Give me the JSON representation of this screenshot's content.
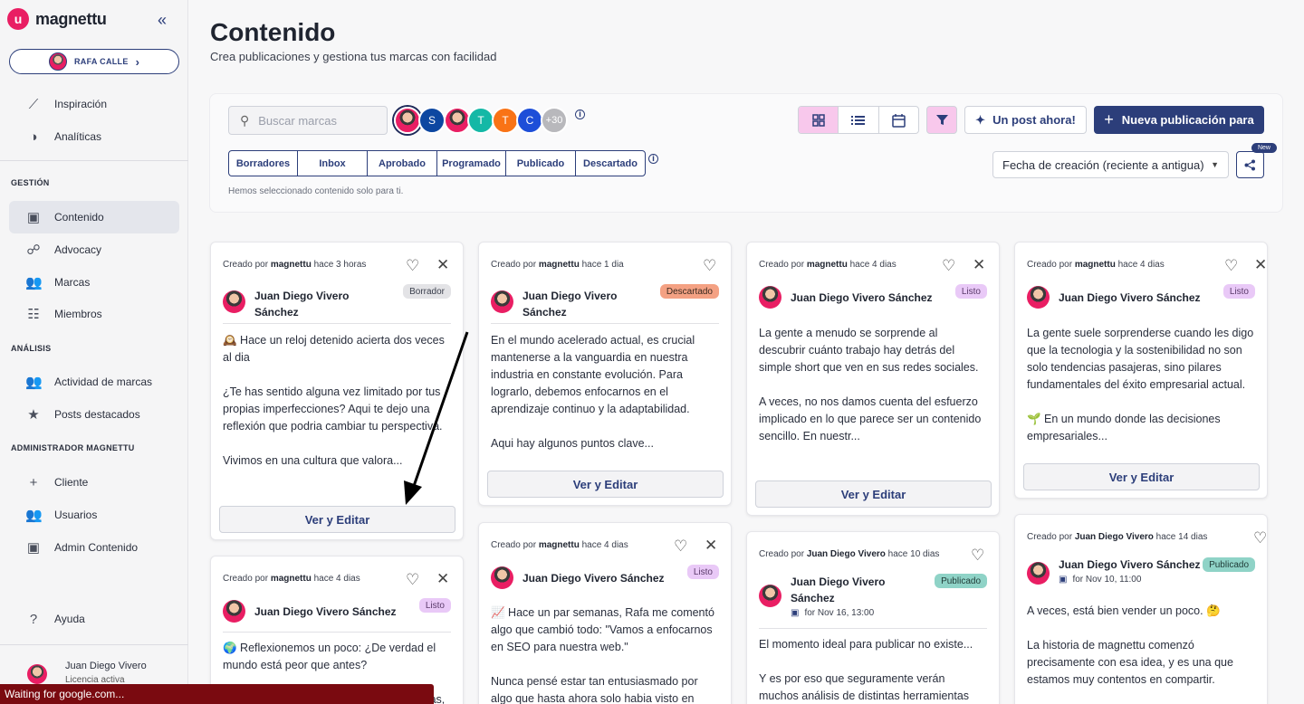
{
  "app": {
    "name": "magnettu",
    "logo_letter": "u",
    "collapse_icon": "«"
  },
  "user_pill": {
    "name": "RAFA CALLE",
    "chevron": "›"
  },
  "nav": {
    "top": [
      {
        "label": "Inspiración",
        "icon": "⟋"
      },
      {
        "label": "Analíticas",
        "icon": "◑"
      }
    ],
    "gestion_label": "GESTIÓN",
    "gestion": [
      {
        "label": "Contenido",
        "icon": "▣"
      },
      {
        "label": "Advocacy",
        "icon": "☍"
      },
      {
        "label": "Marcas",
        "icon": "👥"
      },
      {
        "label": "Miembros",
        "icon": "☷"
      }
    ],
    "analisis_label": "ANÁLISIS",
    "analisis": [
      {
        "label": "Actividad de marcas",
        "icon": "👥"
      },
      {
        "label": "Posts destacados",
        "icon": "★"
      }
    ],
    "admin_label": "ADMINISTRADOR MAGNETTU",
    "admin": [
      {
        "label": "Cliente",
        "icon": "+"
      },
      {
        "label": "Usuarios",
        "icon": "👥"
      },
      {
        "label": "Admin Contenido",
        "icon": "▣"
      }
    ],
    "help": {
      "label": "Ayuda",
      "icon": "?"
    }
  },
  "bottom_user": {
    "name": "Juan Diego Vivero",
    "subtitle": "Licencia activa"
  },
  "header": {
    "title": "Contenido",
    "subtitle": "Crea publicaciones y gestiona tus marcas con facilidad"
  },
  "toolbar": {
    "search_placeholder": "Buscar marcas",
    "brand_avatars": [
      {
        "text": "",
        "color": "#e91e63"
      },
      {
        "text": "S",
        "color": "#0d47a1"
      },
      {
        "text": "",
        "color": "#e91e63"
      },
      {
        "text": "T",
        "color": "#14b8a6"
      },
      {
        "text": "T",
        "color": "#f97316"
      },
      {
        "text": "C",
        "color": "#1d4ed8"
      },
      {
        "text": "+30",
        "color": "#b8b8bc"
      }
    ],
    "views": [
      "grid-icon",
      "list-icon",
      "calendar-icon"
    ],
    "ai_button": "Un post ahora!",
    "new_button": "Nueva publicación para",
    "tabs": [
      "Borradores",
      "Inbox",
      "Aprobado",
      "Programado",
      "Publicado",
      "Descartado"
    ],
    "hint": "Hemos seleccionado contenido solo para ti.",
    "sort_value": "Fecha de creación (reciente a antigua)",
    "new_badge": "New"
  },
  "cards": [
    {
      "meta_prefix": "Creado por",
      "creator": "magnettu",
      "time": "hace 3 horas",
      "author": "Juan Diego Vivero Sánchez",
      "status": "Borrador",
      "status_class": "st-borrador",
      "body": "🕰️ Hace un reloj detenido acierta dos veces al dia\n\n¿Te has sentido alguna vez limitado por tus propias imperfecciones? Aqui te dejo una reflexión que podria cambiar tu perspectiva.\n\nVivimos en una cultura que valora...",
      "button": "Ver y Editar"
    },
    {
      "meta_prefix": "Creado por",
      "creator": "magnettu",
      "time": "hace 1 dia",
      "author": "Juan Diego Vivero Sánchez",
      "status": "Descartado",
      "status_class": "st-descartado",
      "body": "En el mundo acelerado actual, es crucial mantenerse a la vanguardia en nuestra industria en constante evolución. Para lograrlo, debemos enfocarnos en el aprendizaje continuo y la adaptabilidad.\n\nAqui hay algunos puntos clave...",
      "button": "Ver y Editar"
    },
    {
      "meta_prefix": "Creado por",
      "creator": "magnettu",
      "time": "hace 4 dias",
      "author": "Juan Diego Vivero Sánchez",
      "status": "Listo",
      "status_class": "st-listo",
      "body": "La gente a menudo se sorprende al descubrir cuánto trabajo hay detrás del simple short que ven en sus redes sociales.\n\nA veces, no nos damos cuenta del esfuerzo implicado en lo que parece ser un contenido sencillo. En nuestr...",
      "button": "Ver y Editar"
    },
    {
      "meta_prefix": "Creado por",
      "creator": "magnettu",
      "time": "hace 4 dias",
      "author": "Juan Diego Vivero Sánchez",
      "status": "Listo",
      "status_class": "st-listo",
      "body": "La gente suele sorprenderse cuando les digo que la tecnologia y la sostenibilidad no son solo tendencias pasajeras, sino pilares fundamentales del éxito empresarial actual.\n\n🌱 En un mundo donde las decisiones empresariales...",
      "button": "Ver y Editar"
    },
    {
      "meta_prefix": "Creado por",
      "creator": "magnettu",
      "time": "hace 4 dias",
      "author": "Juan Diego Vivero Sánchez",
      "status": "Listo",
      "status_class": "st-listo",
      "body": "🌍 Reflexionemos un poco: ¿De verdad el mundo está peor que antes?\n\nA veces, nos dejamos llevar por las noticias,"
    },
    {
      "meta_prefix": "Creado por",
      "creator": "magnettu",
      "time": "hace 4 dias",
      "author": "Juan Diego Vivero Sánchez",
      "status": "Listo",
      "status_class": "st-listo",
      "body": "📈 Hace un par semanas, Rafa me comentó algo que cambió todo: \"Vamos a enfocarnos en SEO para nuestra web.\"\n\nNunca pensé estar tan entusiasmado por algo que hasta ahora solo habia visto en"
    },
    {
      "meta_prefix": "Creado por",
      "creator": "Juan Diego Vivero",
      "time": "hace 10 dias",
      "author": "Juan Diego Vivero Sánchez",
      "status": "Publicado",
      "status_class": "st-publicado",
      "schedule": "for Nov 16, 13:00",
      "body": "El momento ideal para publicar no existe...\n\nY es por eso que seguramente verán muchos análisis de distintas herramientas"
    },
    {
      "meta_prefix": "Creado por",
      "creator": "Juan Diego Vivero",
      "time": "hace 14 dias",
      "author": "Juan Diego Vivero Sánchez",
      "status": "Publicado",
      "status_class": "st-publicado",
      "schedule": "for Nov 10, 11:00",
      "body": "A veces, está bien vender un poco. 🤔\n\nLa historia de magnettu comenzó precisamente con esa idea, y es una que estamos muy contentos en compartir."
    }
  ],
  "status_bar": "Waiting for google.com..."
}
